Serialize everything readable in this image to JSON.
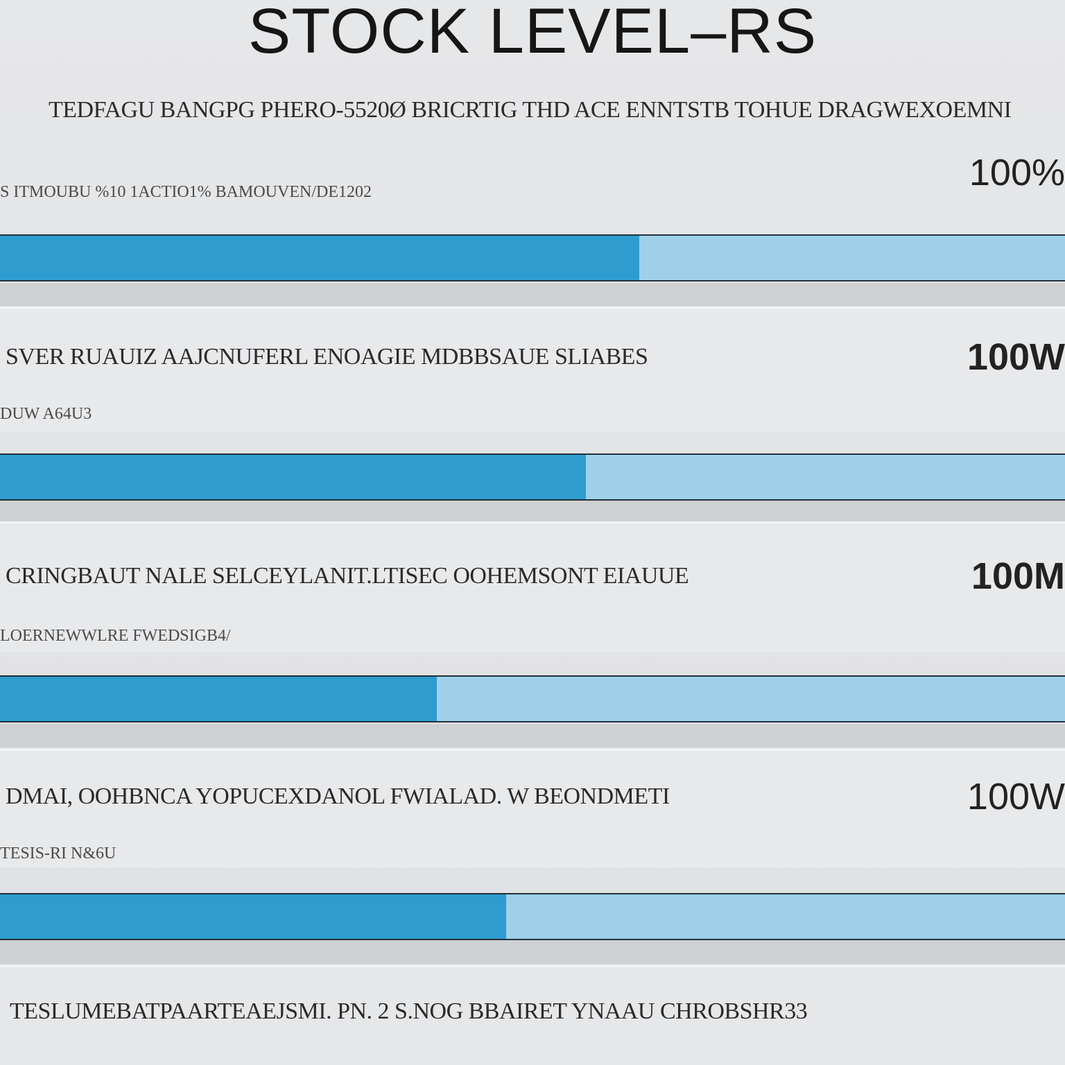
{
  "header": {
    "title": "STOCK LEVEL–RS",
    "subtitle": "TEDFAGU BANGPG PHERO-5520Ø BRICRTIG THD ACE ENNTSTB TOHUE DRAGWEXOEMNI"
  },
  "rows": [
    {
      "caption": "S ITMOUBU %10   1ACTIO1% BAMOUVEN/DE1202",
      "label": "",
      "percent_text": "100%",
      "stock_fraction": 0.6
    },
    {
      "caption": "DUW A64U3",
      "label": "SVER RUAUIZ AAJCNUFERL ENOAGIE MDBBSAUE SLIABES",
      "percent_text": "100W",
      "stock_fraction": 0.55
    },
    {
      "caption": "LOERNEWWLRE FWEDSIGB4/",
      "label": "CRINGBAUT NALE SELCEYLANIT.LTISEC OOHEMSONT EIAUUE",
      "percent_text": "100M",
      "stock_fraction": 0.41
    },
    {
      "caption": "TESIS-RI N&6U",
      "label": "DMAI, OOHBNCA YOPUCEXDANOL FWIALAD. W BEONDMETI",
      "percent_text": "100W",
      "stock_fraction": 0.475
    }
  ],
  "footer": {
    "text": "TESLUMEBATPAARTEAEJSMI. PN. 2 S.NOG BBAIRET YNAAU CHROBSHR33"
  },
  "colors": {
    "fill": "#2e9ccf",
    "track": "#9ed0ea",
    "background": "#e2e3e5"
  }
}
